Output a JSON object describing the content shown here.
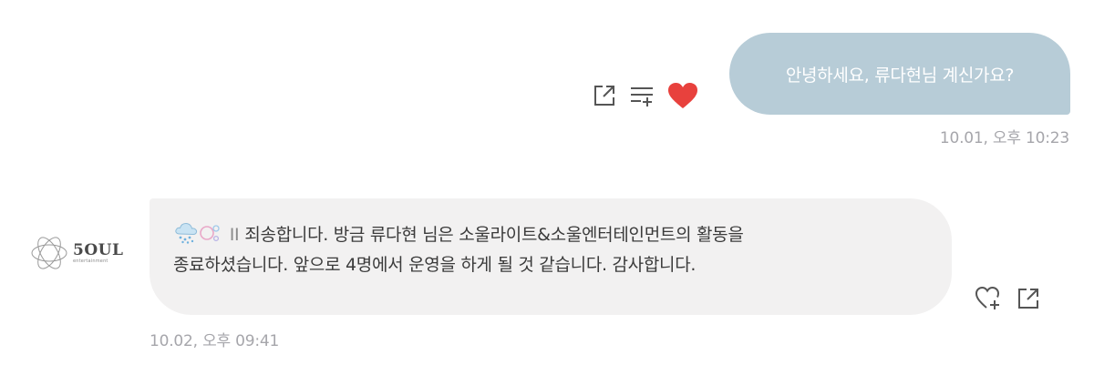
{
  "messages": {
    "outgoing": {
      "text": "안녕하세요, 류다현님 계신가요?",
      "timestamp": "10.01, 오후 10:23",
      "actions": [
        "share-icon",
        "add-to-list-icon",
        "heart-filled-icon"
      ],
      "liked": true,
      "colors": {
        "bubble": "#b7ccd7",
        "heart": "#e8413d"
      }
    },
    "incoming": {
      "sender_logo": "5OUL",
      "sender_logo_sub": "entertainment",
      "emoji": [
        "rain-cloud-icon",
        "bubbles-icon"
      ],
      "prefix": "II",
      "lines": [
        "죄송합니다. 방금 류다현 님은 소울라이트&소울엔터테인먼트의 활동을",
        "종료하셨습니다. 앞으로 4명에서 운영을 하게 될 것 같습니다. 감사합니다."
      ],
      "timestamp": "10.02, 오후 09:41",
      "actions": [
        "heart-add-icon",
        "share-icon"
      ],
      "colors": {
        "bubble": "#f2f1f1"
      }
    }
  }
}
